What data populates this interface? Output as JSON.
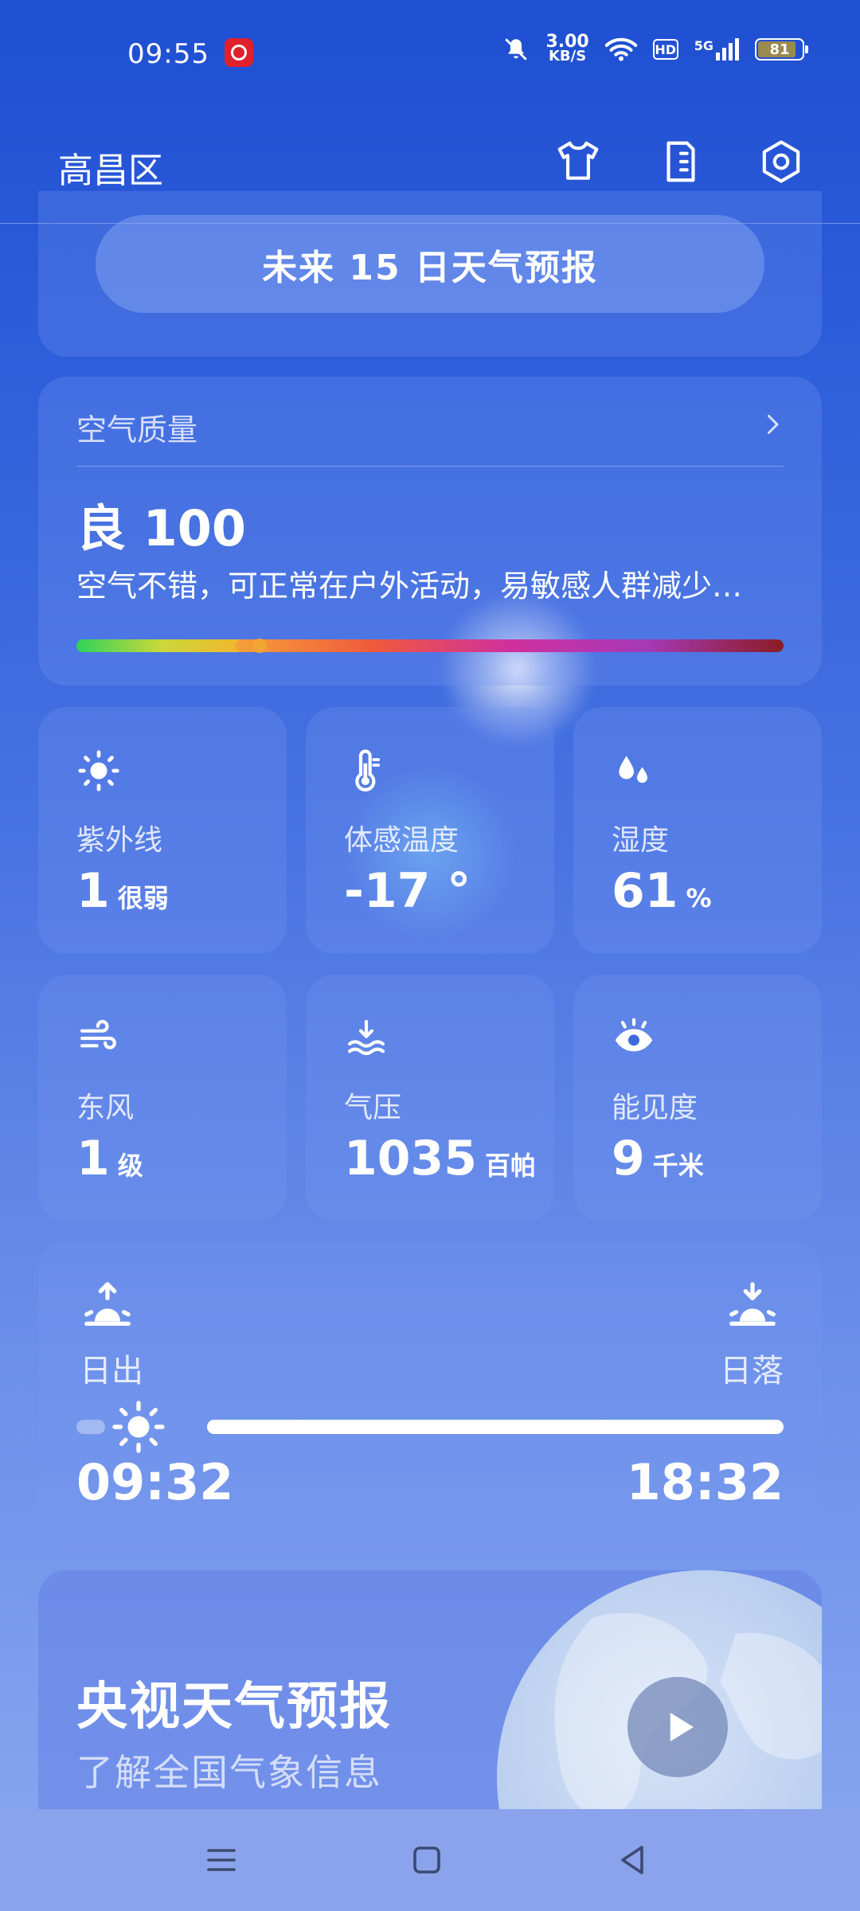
{
  "status_bar": {
    "time": "09:55",
    "speed_value": "3.00",
    "speed_unit": "KB/S",
    "hd": "HD",
    "network": "5G",
    "battery": "81"
  },
  "header": {
    "location": "高昌区",
    "icons": [
      "tshirt-icon",
      "document-icon",
      "settings-icon"
    ]
  },
  "forecast": {
    "button_label": "未来 15 日天气预报"
  },
  "air_quality": {
    "title": "空气质量",
    "value": "良 100",
    "description": "空气不错，可正常在户外活动，易敏感人群减少…"
  },
  "tiles": [
    {
      "icon": "sun-icon",
      "label": "紫外线",
      "value": "1",
      "unit": "很弱"
    },
    {
      "icon": "thermometer-icon",
      "label": "体感温度",
      "value": "-17 °",
      "unit": ""
    },
    {
      "icon": "humidity-icon",
      "label": "湿度",
      "value": "61",
      "unit": "%"
    },
    {
      "icon": "wind-icon",
      "label": "东风",
      "value": "1",
      "unit": "级"
    },
    {
      "icon": "pressure-icon",
      "label": "气压",
      "value": "1035",
      "unit": "百帕"
    },
    {
      "icon": "eye-icon",
      "label": "能见度",
      "value": "9",
      "unit": "千米"
    }
  ],
  "sun": {
    "sunrise_label": "日出",
    "sunset_label": "日落",
    "sunrise_time": "09:32",
    "sunset_time": "18:32",
    "progress": 0.04
  },
  "cctv": {
    "title": "央视天气预报",
    "subtitle": "了解全国气象信息"
  },
  "nav": [
    "menu-icon",
    "home-icon",
    "back-icon"
  ]
}
